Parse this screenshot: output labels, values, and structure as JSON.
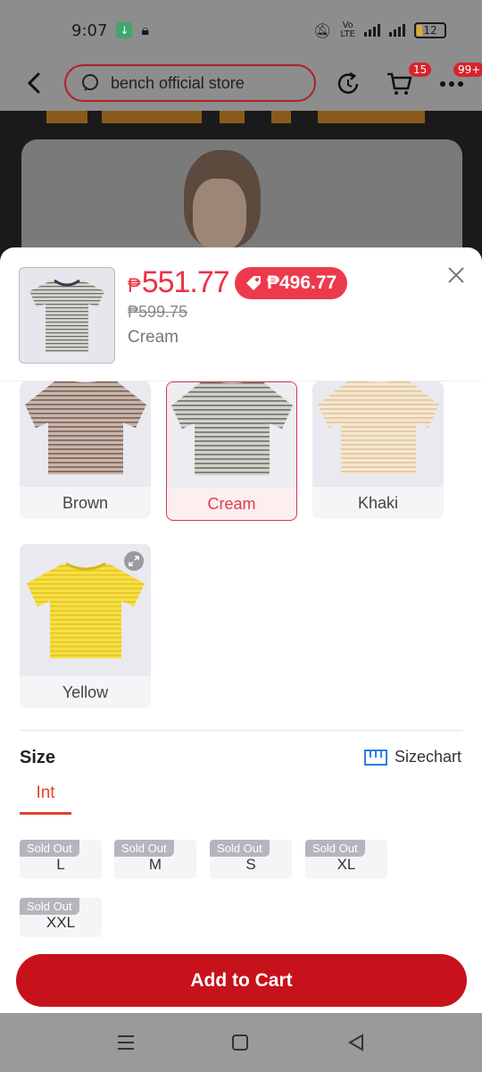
{
  "status_bar": {
    "time": "9:07",
    "battery": "12"
  },
  "nav": {
    "search_text": "bench official store",
    "cart_count": "15",
    "more_count": "99+"
  },
  "product": {
    "price": "551.77",
    "currency": "₱",
    "voucher_price": "₱496.77",
    "original_price": "₱599.75",
    "selected_variant": "Cream"
  },
  "colors": [
    {
      "label": "Brown",
      "swatch": "#8d7468",
      "selected": false
    },
    {
      "label": "Cream",
      "swatch": "#a9a9a2",
      "selected": true
    },
    {
      "label": "Khaki",
      "swatch": "#ead5b3",
      "selected": false
    },
    {
      "label": "Yellow",
      "swatch": "#f0d534",
      "selected": false
    }
  ],
  "size": {
    "title": "Size",
    "sizechart_label": "Sizechart",
    "tab": "Int",
    "sold_out_label": "Sold Out",
    "options": [
      "L",
      "M",
      "S",
      "XL",
      "XXL"
    ]
  },
  "actions": {
    "add_to_cart": "Add to Cart"
  },
  "theme": {
    "accent": "#ea3344",
    "cart_button": "#c8121b"
  }
}
